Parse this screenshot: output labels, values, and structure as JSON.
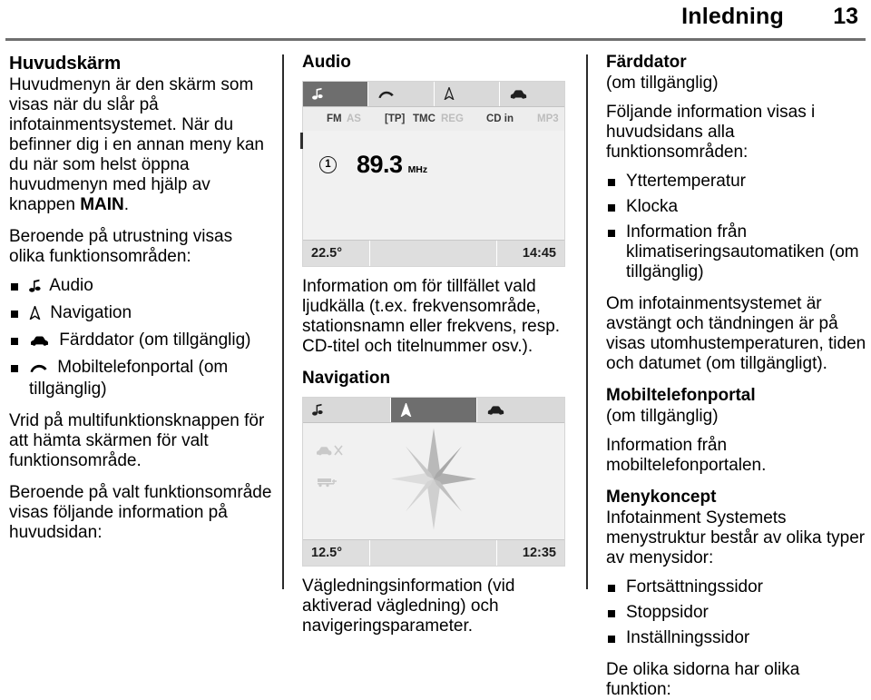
{
  "header": {
    "title": "Inledning",
    "page_number": "13"
  },
  "left_column": {
    "heading": "Huvudskärm",
    "para1_a": "Huvudmenyn är den skärm som visas när du slår på infotainmentsystemet. När du befinner dig i en annan meny kan du när som helst öppna huvudmenyn med hjälp av knappen ",
    "para1_bold": "MAIN",
    "para1_b": ".",
    "para2": "Beroende på utrustning visas olika funktionsområden:",
    "function_areas": [
      {
        "icon": "music-note-icon",
        "label": "Audio"
      },
      {
        "icon": "navigation-arrow-icon",
        "label": "Navigation"
      },
      {
        "icon": "car-icon",
        "label": "Färddator (om tillgänglig)"
      },
      {
        "icon": "phone-handset-icon",
        "label": "Mobiltelefonportal (om tillgänglig)"
      }
    ],
    "para3": "Vrid på multifunktionsknappen för att hämta skärmen för valt funktionsområde.",
    "para4": "Beroende på valt funktionsområde visas följande information på huvudsidan:"
  },
  "middle_column": {
    "audio_heading": "Audio",
    "audio_screen": {
      "tabs": [
        {
          "icon": "music-note-icon",
          "active": true
        },
        {
          "icon": "phone-handset-icon",
          "active": false
        },
        {
          "icon": "navigation-arrow-icon",
          "active": false
        },
        {
          "icon": "car-icon",
          "active": false
        }
      ],
      "status_items": [
        {
          "text": "FM",
          "state": "on"
        },
        {
          "text": "AS",
          "state": "off"
        },
        {
          "text": "[TP]",
          "state": "on"
        },
        {
          "text": "TMC",
          "state": "on"
        },
        {
          "text": "REG",
          "state": "off"
        },
        {
          "text": "CD in",
          "state": "on"
        },
        {
          "text": "MP3",
          "state": "off"
        }
      ],
      "preset": "1",
      "frequency": "89.3",
      "frequency_unit": "MHz",
      "temperature": "22.5°",
      "clock": "14:45"
    },
    "audio_caption": "Information om för tillfället vald ljudkälla (t.ex. frekvensområde, stationsnamn eller frekvens, resp. CD-titel och titelnummer osv.).",
    "navigation_heading": "Navigation",
    "navigation_screen": {
      "tabs": [
        {
          "icon": "music-note-icon",
          "active": false
        },
        {
          "icon": "navigation-arrow-icon",
          "active": true
        },
        {
          "icon": "car-icon",
          "active": false
        }
      ],
      "side_icons": [
        "no-car-route-icon",
        "car-transport-icon"
      ],
      "center_graphic": "compass-rose-icon",
      "temperature": "12.5°",
      "clock": "12:35"
    },
    "navigation_caption": "Vägledningsinformation (vid aktiverad vägledning) och navigeringsparameter."
  },
  "right_column": {
    "trip_computer": {
      "heading": "Färddator",
      "subheading": "(om tillgänglig)",
      "intro": "Följande information visas i huvudsidans alla funktionsområden:",
      "bullets": [
        "Yttertemperatur",
        "Klocka",
        "Information från klimatiseringsautomatiken (om tillgänglig)"
      ],
      "para": "Om infotainmentsystemet är avstängt och tändningen är på visas utomhustemperaturen, tiden och datumet (om tillgängligt)."
    },
    "phone_portal": {
      "heading": "Mobiltelefonportal",
      "subheading": "(om tillgänglig)",
      "para": "Information från mobiltelefonportalen."
    },
    "menu_concept": {
      "heading": "Menykoncept",
      "intro": "Infotainment Systemets menystruktur består av olika typer av menysidor:",
      "bullets": [
        "Fortsättningssidor",
        "Stoppsidor",
        "Inställningssidor"
      ],
      "closing": "De olika sidorna har olika funktion:"
    }
  },
  "colors": {
    "rule": "#6f6f6f",
    "screen_tab_active": "#6e6e6e",
    "screen_tab_bg": "#d9d9d9",
    "screen_body": "#f1f1f1",
    "screen_bottom": "#dedede",
    "status_on": "#3a3a3a",
    "status_off": "#bdbdbd"
  }
}
